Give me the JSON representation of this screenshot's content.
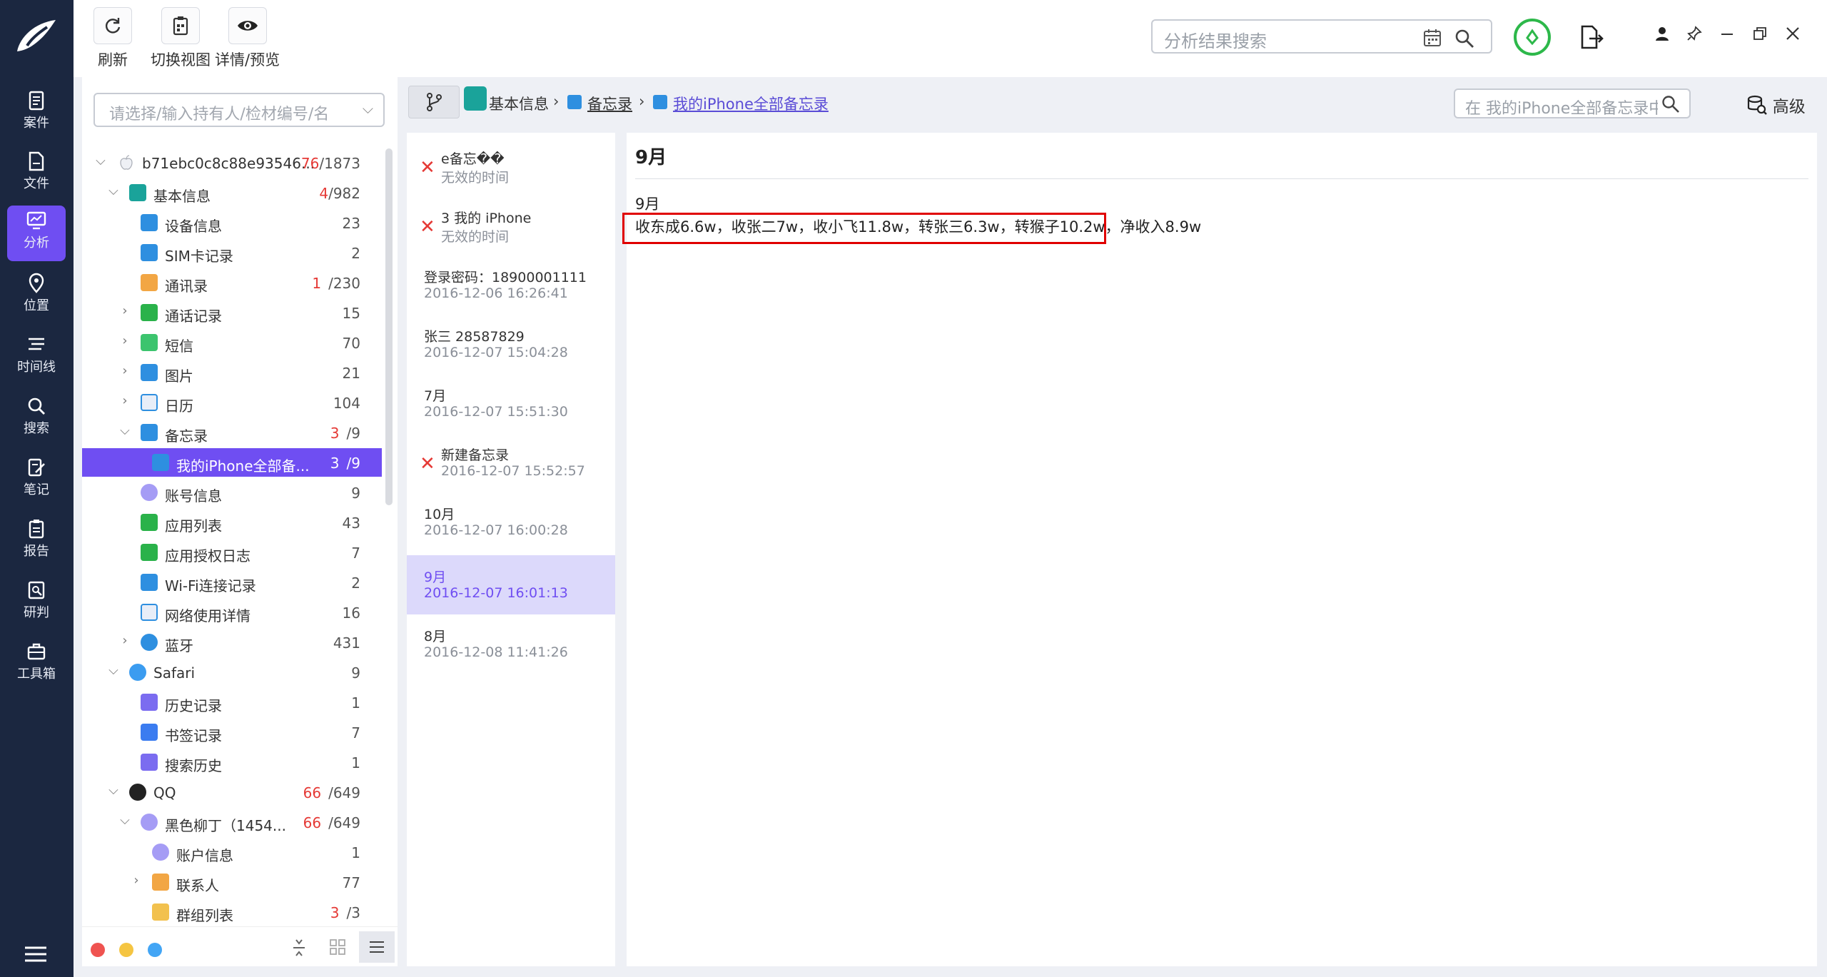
{
  "toolbar": {
    "refresh_label": "刷新",
    "switch_view_label": "切换视图",
    "details_label": "详情/预览",
    "search_placeholder": "分析结果搜索"
  },
  "nav": {
    "items": [
      {
        "label": "案件"
      },
      {
        "label": "文件"
      },
      {
        "label": "分析"
      },
      {
        "label": "位置"
      },
      {
        "label": "时间线"
      },
      {
        "label": "搜索"
      },
      {
        "label": "笔记"
      },
      {
        "label": "报告"
      },
      {
        "label": "研判"
      },
      {
        "label": "工具箱"
      }
    ]
  },
  "tree": {
    "filter_placeholder": "请选择/输入持有人/检材编号/名",
    "rows": [
      {
        "label": "b71ebc0c8c88e93546...",
        "red": "76",
        "count": "/1873"
      },
      {
        "label": "基本信息",
        "red": "4",
        "count": "/982"
      },
      {
        "label": "设备信息",
        "count": "23"
      },
      {
        "label": "SIM卡记录",
        "count": "2"
      },
      {
        "label": "通讯录",
        "red": "1",
        "count": "/230"
      },
      {
        "label": "通话记录",
        "count": "15"
      },
      {
        "label": "短信",
        "count": "70"
      },
      {
        "label": "图片",
        "count": "21"
      },
      {
        "label": "日历",
        "count": "104"
      },
      {
        "label": "备忘录",
        "red": "3",
        "count": "/9"
      },
      {
        "label": "我的iPhone全部备...",
        "red": "3",
        "count": "/9"
      },
      {
        "label": "账号信息",
        "count": "9"
      },
      {
        "label": "应用列表",
        "count": "43"
      },
      {
        "label": "应用授权日志",
        "count": "7"
      },
      {
        "label": "Wi-Fi连接记录",
        "count": "2"
      },
      {
        "label": "网络使用详情",
        "count": "16"
      },
      {
        "label": "蓝牙",
        "count": "431"
      },
      {
        "label": "Safari",
        "count": "9"
      },
      {
        "label": "历史记录",
        "count": "1"
      },
      {
        "label": "书签记录",
        "count": "7"
      },
      {
        "label": "搜索历史",
        "count": "1"
      },
      {
        "label": "QQ",
        "red": "66",
        "count": "/649"
      },
      {
        "label": "黑色柳丁（1454...",
        "red": "66",
        "count": "/649"
      },
      {
        "label": "账户信息",
        "count": "1"
      },
      {
        "label": "联系人",
        "count": "77"
      },
      {
        "label": "群组列表",
        "red": "3",
        "count": "/3"
      }
    ]
  },
  "breadcrumb": {
    "level1": "基本信息",
    "level2": "备忘录",
    "level3": "我的iPhone全部备忘录",
    "search_placeholder": "在 我的iPhone全部备忘录中搜索",
    "advanced_label": "高级"
  },
  "notes": [
    {
      "title": "e备忘��",
      "date": "无效的时间"
    },
    {
      "title": "3  我的 iPhone",
      "date": "无效的时间"
    },
    {
      "title": "登录密码：18900001111",
      "date": "2016-12-06 16:26:41"
    },
    {
      "title": "张三 28587829",
      "date": "2016-12-07 15:04:28"
    },
    {
      "title": "7月",
      "date": "2016-12-07 15:51:30"
    },
    {
      "title": "新建备忘录",
      "date": "2016-12-07 15:52:57"
    },
    {
      "title": "10月",
      "date": "2016-12-07 16:00:28"
    },
    {
      "title": "9月",
      "date": "2016-12-07 16:01:13"
    },
    {
      "title": "8月",
      "date": "2016-12-08 11:41:26"
    }
  ],
  "detail": {
    "title": "9月",
    "line1": "9月",
    "line2": "收东成6.6w，收张二7w，收小飞11.8w，转张三6.3w，转猴子10.2w，净收入8.9w"
  },
  "colors": {
    "nav_bg": "#1b2740",
    "accent": "#6f4ef2",
    "count_red": "#e53935",
    "highlight_border": "#e00000"
  }
}
